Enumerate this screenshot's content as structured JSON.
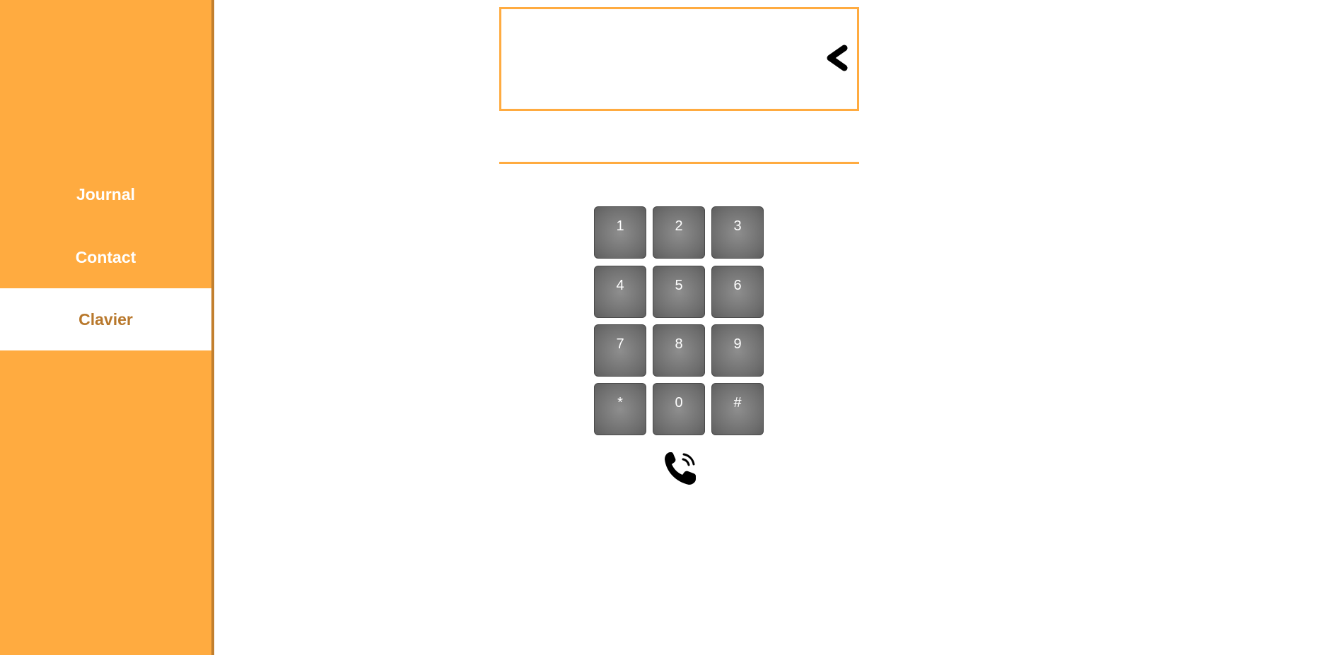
{
  "sidebar": {
    "items": [
      {
        "label": "Journal",
        "active": false
      },
      {
        "label": "Contact",
        "active": false
      },
      {
        "label": "Clavier",
        "active": true
      }
    ]
  },
  "dialer": {
    "number_value": "",
    "keys": [
      "1",
      "2",
      "3",
      "4",
      "5",
      "6",
      "7",
      "8",
      "9",
      "*",
      "0",
      "#"
    ]
  },
  "icons": {
    "backspace": "chevron-left-icon",
    "call": "phone-call-icon"
  },
  "colors": {
    "accent": "#ffab40",
    "accent_dark": "#c27f2e",
    "active_text": "#b8782c",
    "key_bg": "#6e6e6e"
  }
}
